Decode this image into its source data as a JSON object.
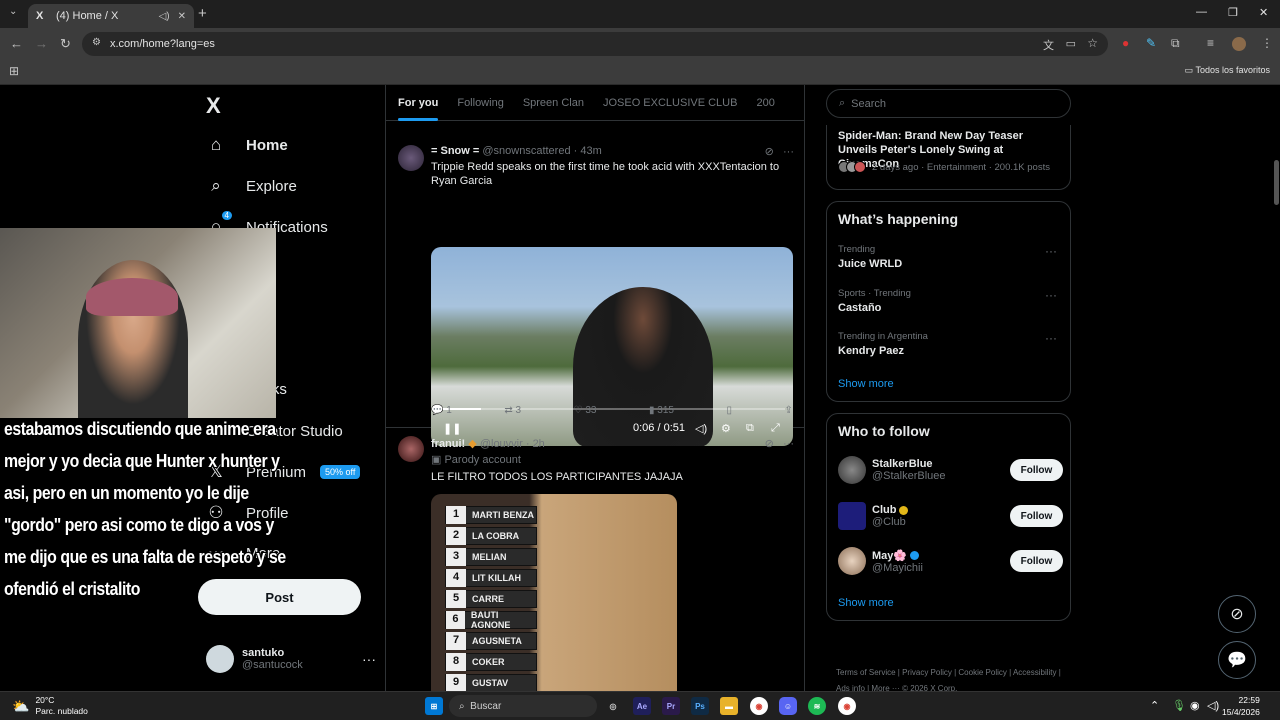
{
  "browser": {
    "tab_title": "(4) Home / X",
    "tab_favicon": "X",
    "url": "x.com/home?lang=es",
    "bookmarks_all": "Todos los favoritos"
  },
  "nav": {
    "logo": "X",
    "items": [
      {
        "label": "Home",
        "icon": "home-icon",
        "glyph": "⌂"
      },
      {
        "label": "Explore",
        "icon": "search-icon",
        "glyph": "⌕"
      },
      {
        "label": "Notifications",
        "icon": "bell-icon",
        "glyph": "🔔",
        "badge": "4"
      },
      {
        "label": "Bookmarks",
        "icon": "bookmark-icon",
        "glyph": "▯",
        "visible_text": "marks"
      },
      {
        "label": "Creator Studio",
        "icon": "creator-icon",
        "glyph": "▤"
      },
      {
        "label": "Premium",
        "icon": "x-premium-icon",
        "glyph": "𝕏"
      },
      {
        "label": "Profile",
        "icon": "profile-icon",
        "glyph": "⚇"
      },
      {
        "label": "More",
        "icon": "more-circle-icon",
        "glyph": "⋯"
      }
    ],
    "premium_badge": "50% off",
    "post_button": "Post",
    "account": {
      "name": "santuko",
      "handle": "@santucock"
    }
  },
  "overlay": {
    "subtitle": "estabamos discutiendo que anime era mejor y yo decia que Hunter x hunter y asi, pero en un momento yo le dije \"gordo\" pero asi como te digo a vos y me dijo que es una falta de respeto y se ofendió el cristalito"
  },
  "feed": {
    "tabs": [
      "For you",
      "Following",
      "Spreen Clan",
      "JOSEO EXCLUSIVE CLUB",
      "200"
    ],
    "tweets": [
      {
        "name": "= Snow =",
        "handle": "@snownscattered",
        "time": "43m",
        "text": "Trippie Redd speaks on the first time he took acid with XXXTentacion to Ryan Garcia",
        "video_time": "0:06 / 0:51",
        "video_progress": 0.12,
        "replies": "1",
        "reposts": "3",
        "likes": "33",
        "views": "315"
      },
      {
        "name": "franui!",
        "handle": "@louvvir",
        "time": "2h",
        "label": "Parody account",
        "text": "LE FILTRO TODOS LOS PARTICIPANTES JAJAJA",
        "ranking": [
          {
            "n": "1",
            "name": "MARTI BENZA"
          },
          {
            "n": "2",
            "name": "LA COBRA"
          },
          {
            "n": "3",
            "name": "MELIAN"
          },
          {
            "n": "4",
            "name": "LIT KILLAH"
          },
          {
            "n": "5",
            "name": "CARRE"
          },
          {
            "n": "6",
            "name": "BAUTI AGNONE"
          },
          {
            "n": "7",
            "name": "AGUSNETA"
          },
          {
            "n": "8",
            "name": "COKER"
          },
          {
            "n": "9",
            "name": "GUSTAV"
          }
        ]
      }
    ]
  },
  "sidebar": {
    "search_placeholder": "Search",
    "news": {
      "title": "Spider-Man: Brand New Day Teaser Unveils Peter's Lonely Swing at CinemaCon",
      "meta": "2 days ago · Entertainment · 200.1K posts"
    },
    "whats_happening": {
      "title": "What’s happening",
      "trends": [
        {
          "category": "Trending",
          "topic": "Juice WRLD"
        },
        {
          "category": "Sports · Trending",
          "topic": "Castaño"
        },
        {
          "category": "Trending in Argentina",
          "topic": "Kendry Paez"
        }
      ],
      "show_more": "Show more"
    },
    "who_to_follow": {
      "title": "Who to follow",
      "accounts": [
        {
          "name": "StalkerBlue",
          "handle": "@StalkerBluee"
        },
        {
          "name": "Club",
          "handle": "@Club",
          "verified": "gold"
        },
        {
          "name": "May🌸",
          "handle": "@Mayichii",
          "verified": "blue"
        }
      ],
      "follow_label": "Follow",
      "show_more": "Show more"
    },
    "footer": "Terms of Service | Privacy Policy | Cookie Policy | Accessibility | Ads info | More ··· © 2026 X Corp."
  },
  "taskbar": {
    "weather_temp": "20°C",
    "weather_desc": "Parc. nublado",
    "search": "Buscar",
    "time": "22:59",
    "date": "15/4/2026"
  },
  "colors": {
    "accent": "#1d9bf0",
    "border": "#2f3336",
    "muted": "#71767b"
  }
}
